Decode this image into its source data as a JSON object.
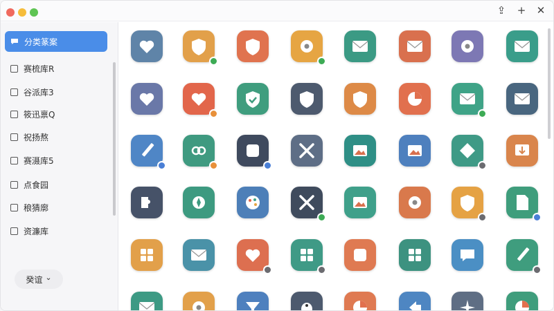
{
  "window": {
    "traffic_colors": [
      "#f06a5e",
      "#f6bd3b",
      "#5fc453"
    ],
    "toolbar_icons": [
      "share-icon",
      "plus-icon",
      "close-icon"
    ],
    "toolbar_glyphs": [
      "⇪",
      "+",
      "✕"
    ]
  },
  "sidebar": {
    "items": [
      {
        "label": "分类篆案",
        "active": true
      },
      {
        "label": "赛梳库R",
        "active": false
      },
      {
        "label": "谷派库3",
        "active": false
      },
      {
        "label": "筱迅禀Q",
        "active": false
      },
      {
        "label": "祝扬熬",
        "active": false
      },
      {
        "label": "赛滠库5",
        "active": false
      },
      {
        "label": "点食园",
        "active": false
      },
      {
        "label": "稂猜廓",
        "active": false
      },
      {
        "label": "资濂库",
        "active": false
      }
    ],
    "more_label": "癸谊",
    "more_icon": "chevron-down-icon",
    "more_glyph": "⌄"
  },
  "grid": {
    "rows": [
      [
        {
          "icon": "heart-shield-icon",
          "bg": "#5f84a8",
          "badge": ""
        },
        {
          "icon": "shield-icon",
          "bg": "#e2a04a",
          "badge": "#3dab55"
        },
        {
          "icon": "shield-crest-icon",
          "bg": "#e0734f",
          "badge": ""
        },
        {
          "icon": "settings-icon",
          "bg": "#e6a543",
          "badge": "#3dab55"
        },
        {
          "icon": "envelope-icon",
          "bg": "#3b9a84",
          "badge": ""
        },
        {
          "icon": "envelope-icon",
          "bg": "#d9704e",
          "badge": ""
        },
        {
          "icon": "gear-badge-icon",
          "bg": "#7d78b4",
          "badge": ""
        },
        {
          "icon": "envelope-icon",
          "bg": "#3a9d8a",
          "badge": ""
        }
      ],
      [
        {
          "icon": "heart-shield-icon",
          "bg": "#6a78a8",
          "badge": ""
        },
        {
          "icon": "heart-icon",
          "bg": "#e2664b",
          "badge": "#e8903a"
        },
        {
          "icon": "shield-check-icon",
          "bg": "#3f9d7e",
          "badge": ""
        },
        {
          "icon": "shield-icon",
          "bg": "#4d5a6e",
          "badge": ""
        },
        {
          "icon": "shield-icon",
          "bg": "#dd8a47",
          "badge": ""
        },
        {
          "icon": "pie-chart-icon",
          "bg": "#e1704e",
          "badge": ""
        },
        {
          "icon": "envelope-icon",
          "bg": "#3fa387",
          "badge": "#3dab55"
        },
        {
          "icon": "envelope-icon",
          "bg": "#49667f",
          "badge": ""
        }
      ],
      [
        {
          "icon": "pen-icon",
          "bg": "#4f86c6",
          "badge": "#4a7fd6"
        },
        {
          "icon": "link-icon",
          "bg": "#3f9a80",
          "badge": "#e8903a"
        },
        {
          "icon": "square-icon",
          "bg": "#3f4a5e",
          "badge": "#4a7fd6"
        },
        {
          "icon": "tools-icon",
          "bg": "#5e6e86",
          "badge": ""
        },
        {
          "icon": "photo-icon",
          "bg": "#2f8f86",
          "badge": ""
        },
        {
          "icon": "photo-icon",
          "bg": "#4e80be",
          "badge": ""
        },
        {
          "icon": "diamond-icon",
          "bg": "#3f9a86",
          "badge": "#6b6b70"
        },
        {
          "icon": "download-icon",
          "bg": "#d9854c",
          "badge": ""
        }
      ],
      [
        {
          "icon": "puzzle-icon",
          "bg": "#465268",
          "badge": ""
        },
        {
          "icon": "compass-icon",
          "bg": "#3d9a80",
          "badge": ""
        },
        {
          "icon": "palette-icon",
          "bg": "#4d7fb8",
          "badge": ""
        },
        {
          "icon": "crossed-tools-icon",
          "bg": "#3f4b5d",
          "badge": "#3dab55"
        },
        {
          "icon": "image-icon",
          "bg": "#3fa08a",
          "badge": ""
        },
        {
          "icon": "gear-icon",
          "bg": "#d9794c",
          "badge": ""
        },
        {
          "icon": "shield-icon",
          "bg": "#e5a244",
          "badge": "#6b6b70"
        },
        {
          "icon": "document-icon",
          "bg": "#3f9d7c",
          "badge": "#4a7fd6"
        }
      ],
      [
        {
          "icon": "grid-icon",
          "bg": "#e2a04a",
          "badge": ""
        },
        {
          "icon": "envelope-icon",
          "bg": "#4a92a8",
          "badge": ""
        },
        {
          "icon": "heart-icon",
          "bg": "#dd6f50",
          "badge": "#6b6b70"
        },
        {
          "icon": "apps-icon",
          "bg": "#3f9a86",
          "badge": "#6b6b70"
        },
        {
          "icon": "square-icon",
          "bg": "#df7a52",
          "badge": ""
        },
        {
          "icon": "apps-icon",
          "bg": "#3d9280",
          "badge": ""
        },
        {
          "icon": "chat-icon",
          "bg": "#4b8fc4",
          "badge": ""
        },
        {
          "icon": "edit-icon",
          "bg": "#3f9d7e",
          "badge": "#6b6b70"
        }
      ],
      [
        {
          "icon": "envelope-icon",
          "bg": "#3d9a84",
          "badge": ""
        },
        {
          "icon": "gear-badge-icon",
          "bg": "#e2a04a",
          "badge": ""
        },
        {
          "icon": "funnel-icon",
          "bg": "#4e80be",
          "badge": ""
        },
        {
          "icon": "bird-icon",
          "bg": "#4d5a6e",
          "badge": ""
        },
        {
          "icon": "pie-chart-icon",
          "bg": "#df7a52",
          "badge": ""
        },
        {
          "icon": "arrow-icon",
          "bg": "#4e86c2",
          "badge": ""
        },
        {
          "icon": "sparkle-icon",
          "bg": "#5f6e84",
          "badge": ""
        },
        {
          "icon": "pie-chart-icon",
          "bg": "#3f9d7c",
          "badge": ""
        }
      ]
    ]
  }
}
